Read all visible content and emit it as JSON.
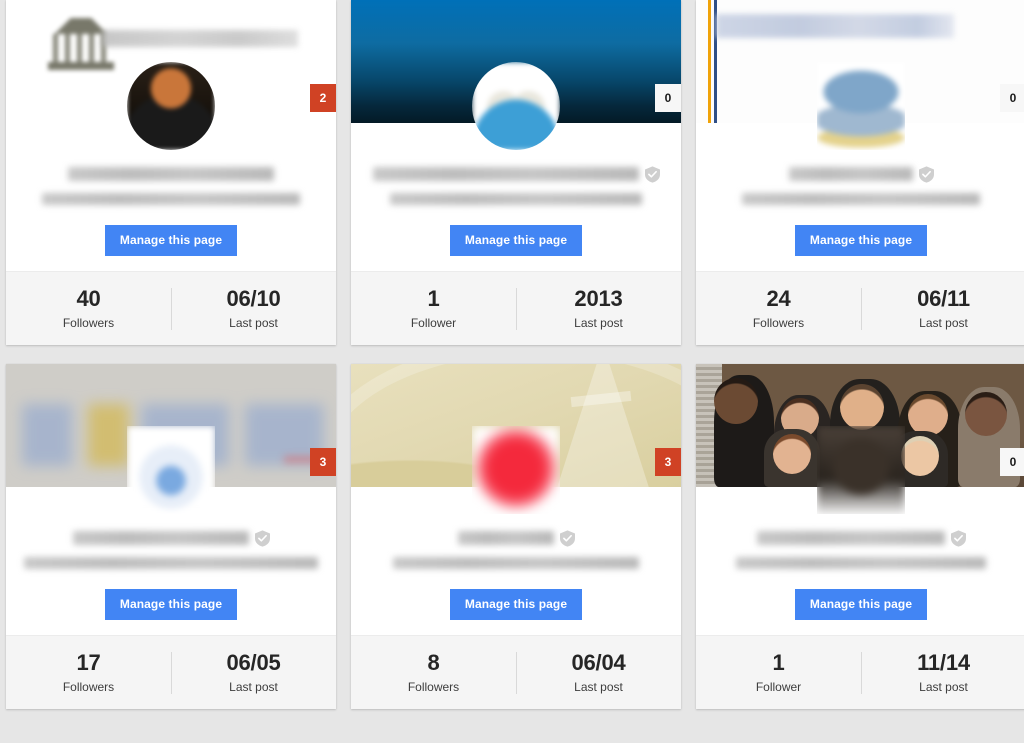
{
  "layout": {
    "columns": 3,
    "rows": 2,
    "background": "#e6e6e6"
  },
  "common": {
    "manage_label": "Manage this page",
    "verified_icon": "shield-check-icon",
    "accent_button": "#4285f4",
    "badge_alert_color": "#d04224",
    "badge_zero_color": "#f7f7f7"
  },
  "cards": [
    {
      "id": "card-1",
      "badge": "2",
      "badge_state": "alert",
      "cover_style": "letterhead",
      "avatar_style": "suit-portrait",
      "avatar_shape": "circle",
      "name_redacted": true,
      "name_width": 206,
      "address_redacted": true,
      "address_width": 258,
      "verified": false,
      "manage_label": "Manage this page",
      "stats": [
        {
          "value": "40",
          "label": "Followers"
        },
        {
          "value": "06/10",
          "label": "Last post"
        }
      ]
    },
    {
      "id": "card-2",
      "badge": "0",
      "badge_state": "zero",
      "cover_style": "blue-gradient",
      "avatar_style": "blue-columns",
      "avatar_shape": "circle",
      "name_redacted": true,
      "name_width": 266,
      "address_redacted": true,
      "address_width": 252,
      "verified": true,
      "manage_label": "Manage this page",
      "stats": [
        {
          "value": "1",
          "label": "Follower"
        },
        {
          "value": "2013",
          "label": "Last post"
        }
      ]
    },
    {
      "id": "card-3",
      "badge": "0",
      "badge_state": "zero",
      "cover_style": "orange-navy-rules",
      "avatar_style": "crest",
      "avatar_shape": "square",
      "name_redacted": true,
      "name_width": 124,
      "address_redacted": true,
      "address_width": 238,
      "verified": true,
      "manage_label": "Manage this page",
      "stats": [
        {
          "value": "24",
          "label": "Followers"
        },
        {
          "value": "06/11",
          "label": "Last post"
        }
      ]
    },
    {
      "id": "card-4",
      "badge": "3",
      "badge_state": "alert",
      "cover_style": "gray-scan",
      "avatar_style": "globe",
      "avatar_shape": "square",
      "name_redacted": true,
      "name_width": 176,
      "address_redacted": true,
      "address_width": 294,
      "verified": true,
      "manage_label": "Manage this page",
      "stats": [
        {
          "value": "17",
          "label": "Followers"
        },
        {
          "value": "06/05",
          "label": "Last post"
        }
      ]
    },
    {
      "id": "card-5",
      "badge": "3",
      "badge_state": "alert",
      "cover_style": "cream-swoosh",
      "avatar_style": "red-roof",
      "avatar_shape": "square",
      "name_redacted": true,
      "name_width": 96,
      "address_redacted": true,
      "address_width": 246,
      "verified": true,
      "manage_label": "Manage this page",
      "stats": [
        {
          "value": "8",
          "label": "Followers"
        },
        {
          "value": "06/04",
          "label": "Last post"
        }
      ]
    },
    {
      "id": "card-6",
      "badge": "0",
      "badge_state": "zero",
      "cover_style": "staff-photo",
      "avatar_style": "dark-portrait",
      "avatar_shape": "square",
      "name_redacted": true,
      "name_width": 188,
      "address_redacted": true,
      "address_width": 250,
      "verified": true,
      "manage_label": "Manage this page",
      "stats": [
        {
          "value": "1",
          "label": "Follower"
        },
        {
          "value": "11/14",
          "label": "Last post"
        }
      ]
    }
  ]
}
